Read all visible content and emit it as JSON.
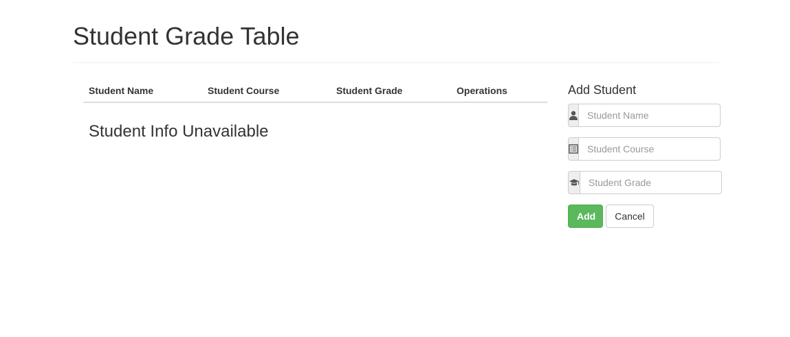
{
  "header": {
    "title": "Student Grade Table"
  },
  "table": {
    "columns": [
      "Student Name",
      "Student Course",
      "Student Grade",
      "Operations"
    ],
    "empty_message": "Student Info Unavailable"
  },
  "form": {
    "title": "Add Student",
    "fields": [
      {
        "icon": "user-icon",
        "placeholder": "Student Name",
        "value": ""
      },
      {
        "icon": "list-alt-icon",
        "placeholder": "Student Course",
        "value": ""
      },
      {
        "icon": "education-icon",
        "placeholder": "Student Grade",
        "value": ""
      }
    ],
    "add_label": "Add",
    "cancel_label": "Cancel"
  },
  "colors": {
    "add_button": "#5cb85c",
    "text": "#333333",
    "addon_bg": "#eeeeee"
  }
}
